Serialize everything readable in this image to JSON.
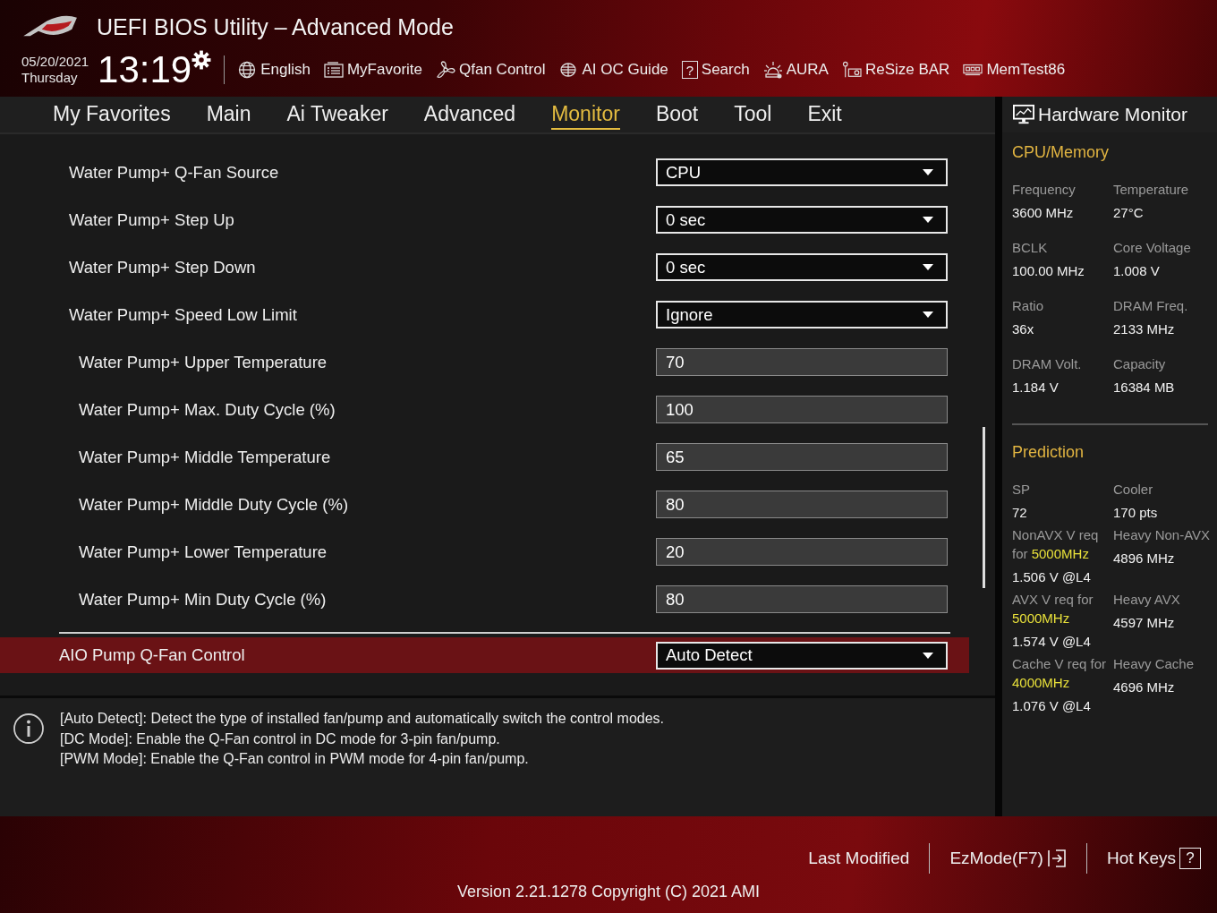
{
  "window": {
    "title": "UEFI BIOS Utility – Advanced Mode"
  },
  "date": "05/20/2021",
  "weekday": "Thursday",
  "time": "13:19",
  "toolbar": [
    {
      "label": "English"
    },
    {
      "label": "MyFavorite"
    },
    {
      "label": "Qfan Control"
    },
    {
      "label": "AI OC Guide"
    },
    {
      "label": "Search",
      "icon_text": "?"
    },
    {
      "label": "AURA"
    },
    {
      "label": "ReSize BAR"
    },
    {
      "label": "MemTest86"
    }
  ],
  "tabs": [
    {
      "label": "My Favorites",
      "selected": false
    },
    {
      "label": "Main",
      "selected": false
    },
    {
      "label": "Ai Tweaker",
      "selected": false
    },
    {
      "label": "Advanced",
      "selected": false
    },
    {
      "label": "Monitor",
      "selected": true
    },
    {
      "label": "Boot",
      "selected": false
    },
    {
      "label": "Tool",
      "selected": false
    },
    {
      "label": "Exit",
      "selected": false
    }
  ],
  "settings": [
    {
      "kind": "dropdown",
      "label": "Water Pump+ Q-Fan Source",
      "value": "CPU",
      "selected": false
    },
    {
      "kind": "dropdown",
      "label": "Water Pump+ Step Up",
      "value": "0 sec",
      "selected": false
    },
    {
      "kind": "dropdown",
      "label": "Water Pump+ Step Down",
      "value": "0 sec",
      "selected": false
    },
    {
      "kind": "dropdown",
      "label": "Water Pump+ Speed Low Limit",
      "value": "Ignore",
      "selected": false,
      "children": [
        {
          "kind": "number",
          "label": "Water Pump+ Upper Temperature",
          "value": "70",
          "selected": false
        },
        {
          "kind": "number",
          "label": "Water Pump+ Max. Duty Cycle (%)",
          "value": "100",
          "selected": false
        },
        {
          "kind": "number",
          "label": "Water Pump+ Middle Temperature",
          "value": "65",
          "selected": false
        },
        {
          "kind": "number",
          "label": "Water Pump+ Middle Duty Cycle (%)",
          "value": "80",
          "selected": false
        },
        {
          "kind": "number",
          "label": "Water Pump+ Lower Temperature",
          "value": "20",
          "selected": false
        },
        {
          "kind": "number",
          "label": "Water Pump+ Min Duty Cycle (%)",
          "value": "80",
          "selected": false
        }
      ]
    },
    {
      "kind": "divider"
    },
    {
      "kind": "dropdown",
      "label": "AIO Pump Q-Fan Control",
      "value": "Auto Detect",
      "selected": true
    }
  ],
  "help": [
    "[Auto Detect]: Detect the type of installed fan/pump and automatically switch the control modes.",
    "[DC Mode]: Enable the Q-Fan control in DC mode for 3-pin fan/pump.",
    "[PWM Mode]: Enable the Q-Fan control in PWM mode for 4-pin fan/pump."
  ],
  "hardware_monitor": {
    "title": "Hardware Monitor",
    "sections": [
      {
        "title": "CPU/Memory",
        "items": [
          {
            "label": "Frequency",
            "value": "3600 MHz"
          },
          {
            "label": "Temperature",
            "value": "27°C"
          },
          {
            "label": "BCLK",
            "value": "100.00 MHz"
          },
          {
            "label": "Core Voltage",
            "value": "1.008 V"
          },
          {
            "label": "Ratio",
            "value": "36x"
          },
          {
            "label": "DRAM Freq.",
            "value": "2133 MHz"
          },
          {
            "label": "DRAM Volt.",
            "value": "1.184 V"
          },
          {
            "label": "Capacity",
            "value": "16384 MB"
          }
        ]
      },
      {
        "title": "Prediction",
        "items": [
          {
            "label": "SP",
            "value": "72"
          },
          {
            "label": "Cooler",
            "value": "170 pts"
          },
          {
            "label": "NonAVX V req for",
            "highlight": "5000MHz",
            "value": "1.506 V @L4"
          },
          {
            "label": "Heavy Non-AVX",
            "value": "4896 MHz"
          },
          {
            "label": "AVX V req    for",
            "highlight": "5000MHz",
            "value": "1.574 V @L4"
          },
          {
            "label": "Heavy AVX",
            "value": "4597 MHz"
          },
          {
            "label": "Cache V req for",
            "highlight": "4000MHz",
            "value": "1.076 V @L4"
          },
          {
            "label": "Heavy Cache",
            "value": "4696 MHz"
          }
        ]
      }
    ]
  },
  "footer": {
    "last_modified": "Last Modified",
    "ez_mode": "EzMode(F7)",
    "hot_keys": "Hot Keys",
    "hot_keys_icon": "?",
    "version": "Version 2.21.1278 Copyright (C) 2021 AMI"
  }
}
